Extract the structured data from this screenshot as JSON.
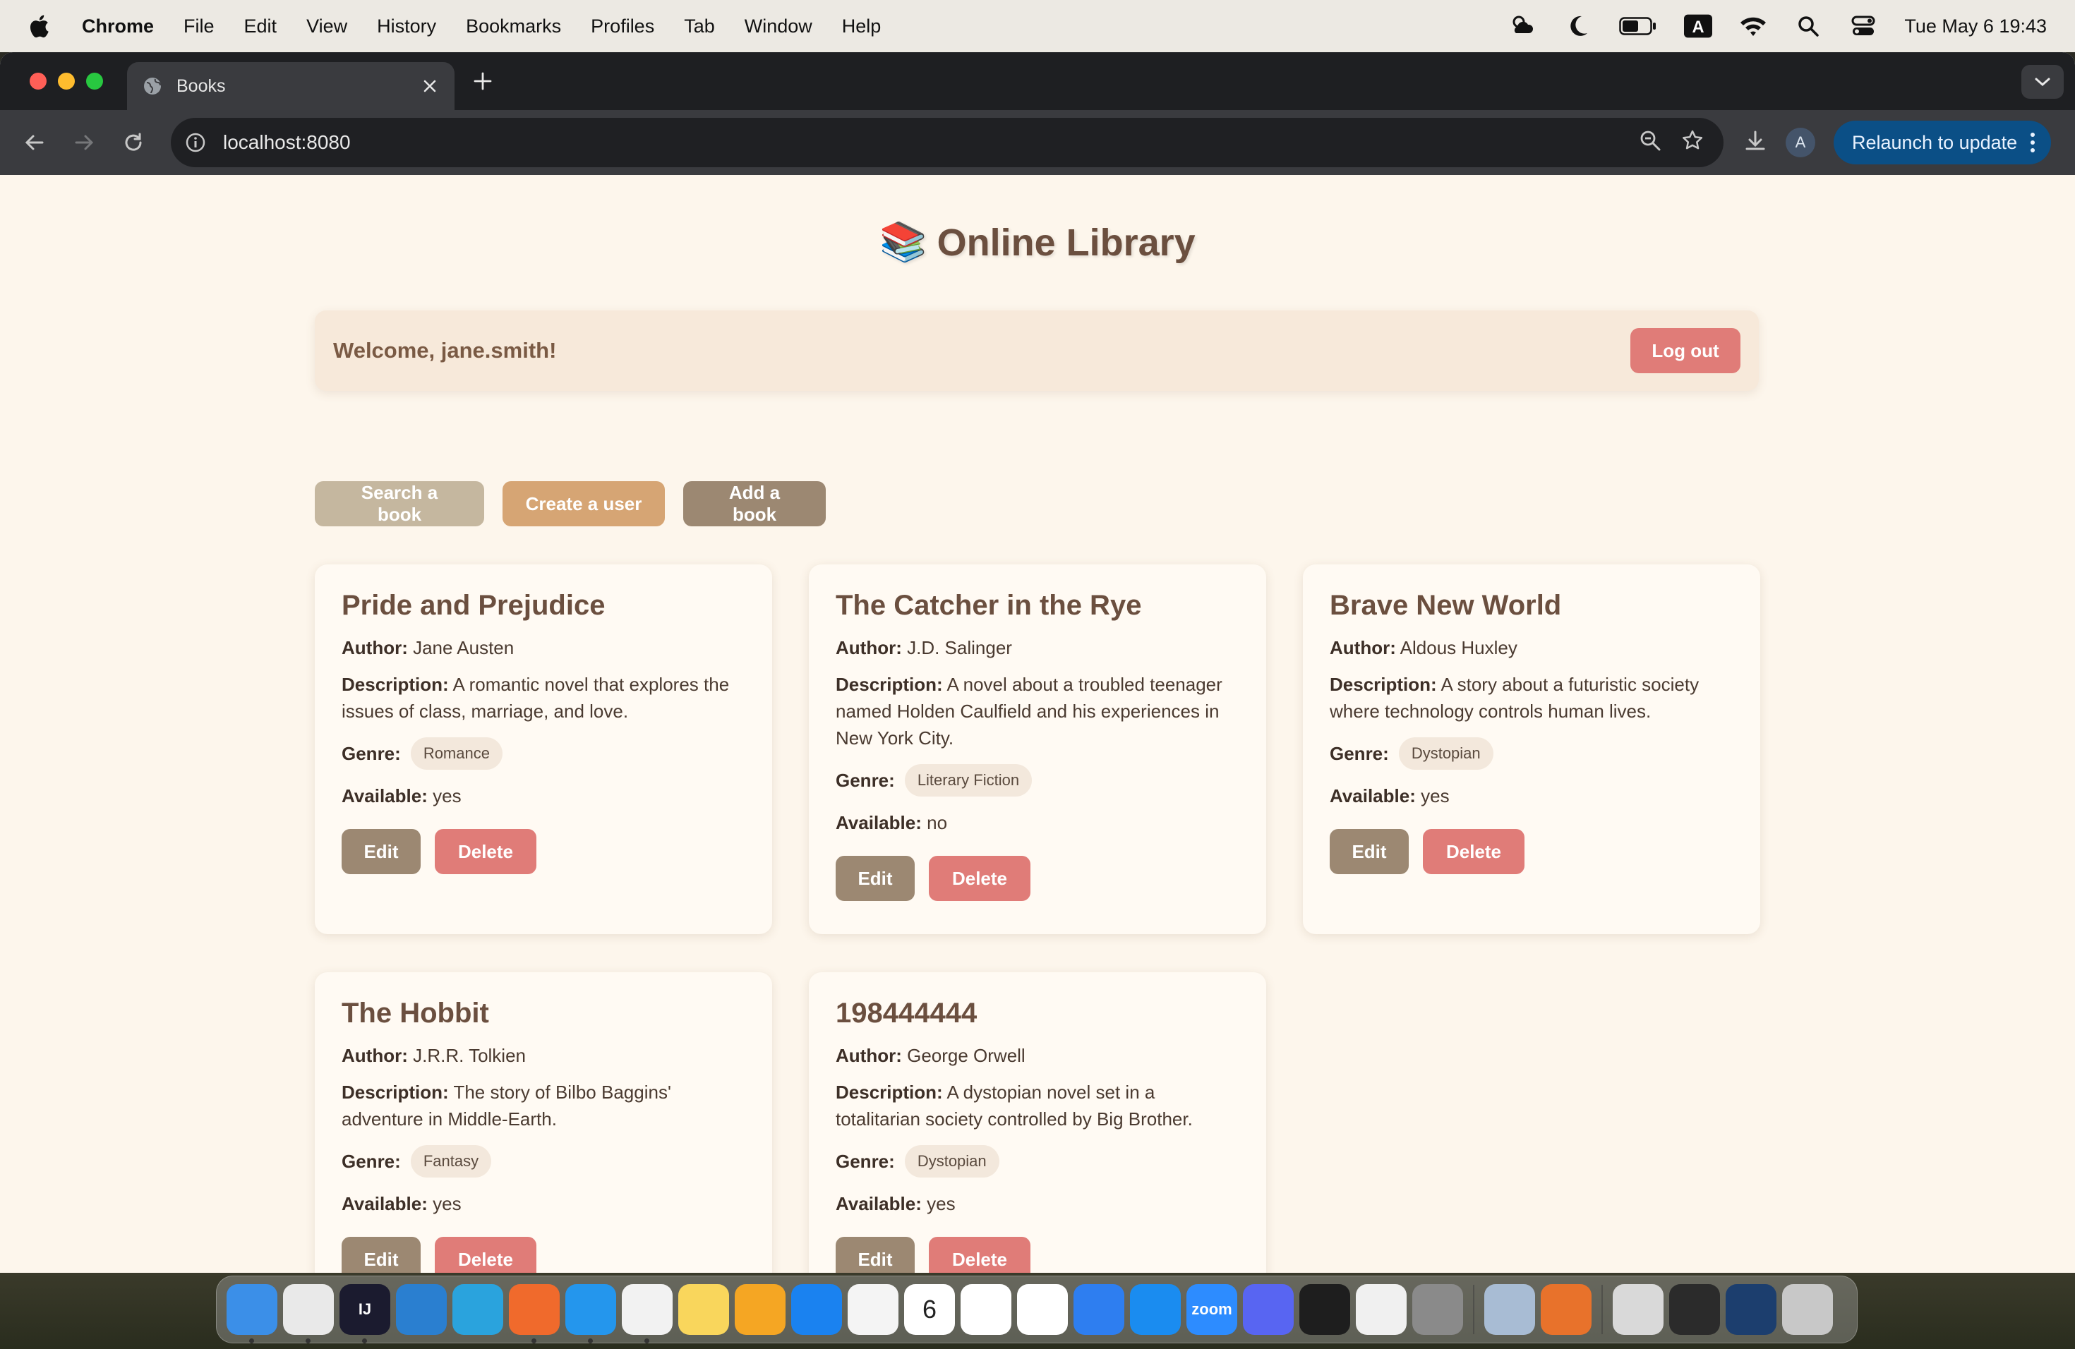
{
  "menubar": {
    "items": [
      "Chrome",
      "File",
      "Edit",
      "View",
      "History",
      "Bookmarks",
      "Profiles",
      "Tab",
      "Window",
      "Help"
    ],
    "clock": "Tue May 6  19:43"
  },
  "browser": {
    "tab_title": "Books",
    "url": "localhost:8080",
    "avatar_letter": "A",
    "relaunch_label": "Relaunch to update"
  },
  "page": {
    "title": "Online Library",
    "title_emoji": "📚",
    "welcome": "Welcome, jane.smith!",
    "logout_label": "Log out",
    "actions": {
      "search": "Search a book",
      "create_user": "Create a user",
      "add_book": "Add a book"
    },
    "labels": {
      "author": "Author:",
      "description": "Description:",
      "genre": "Genre:",
      "available": "Available:",
      "edit": "Edit",
      "delete": "Delete"
    },
    "books": [
      {
        "title": "Pride and Prejudice",
        "author": "Jane Austen",
        "description": "A romantic novel that explores the issues of class, marriage, and love.",
        "genre": "Romance",
        "available": "yes"
      },
      {
        "title": "The Catcher in the Rye",
        "author": "J.D. Salinger",
        "description": "A novel about a troubled teenager named Holden Caulfield and his experiences in New York City.",
        "genre": "Literary Fiction",
        "available": "no"
      },
      {
        "title": "Brave New World",
        "author": "Aldous Huxley",
        "description": "A story about a futuristic society where technology controls human lives.",
        "genre": "Dystopian",
        "available": "yes"
      },
      {
        "title": "The Hobbit",
        "author": "J.R.R. Tolkien",
        "description": "The story of Bilbo Baggins' adventure in Middle-Earth.",
        "genre": "Fantasy",
        "available": "yes"
      },
      {
        "title": "198444444",
        "author": "George Orwell",
        "description": "A dystopian novel set in a totalitarian society controlled by Big Brother.",
        "genre": "Dystopian",
        "available": "yes"
      }
    ]
  },
  "dock": {
    "apps": [
      {
        "name": "finder",
        "color": "#3b8fe8",
        "running": true
      },
      {
        "name": "chrome",
        "color": "#e9e9e9",
        "running": true
      },
      {
        "name": "intellij",
        "color": "#1b1b2f",
        "label": "IJ",
        "running": true
      },
      {
        "name": "vscode",
        "color": "#2a7fd0",
        "running": false
      },
      {
        "name": "telegram",
        "color": "#2aa3dd",
        "running": false
      },
      {
        "name": "postman",
        "color": "#f06a2c",
        "running": true
      },
      {
        "name": "docker",
        "color": "#2496ed",
        "running": true
      },
      {
        "name": "tableplus",
        "color": "#f2f2f2",
        "running": true
      },
      {
        "name": "notes",
        "color": "#f9d65c",
        "running": false
      },
      {
        "name": "pages",
        "color": "#f5a623",
        "running": false
      },
      {
        "name": "safari",
        "color": "#1a82f0",
        "running": false
      },
      {
        "name": "photos",
        "color": "#f4f4f4",
        "running": false
      },
      {
        "name": "calendar",
        "color": "#ffffff",
        "label": "6",
        "running": false
      },
      {
        "name": "reminders",
        "color": "#ffffff",
        "running": false
      },
      {
        "name": "freeform",
        "color": "#ffffff",
        "running": false
      },
      {
        "name": "keynote",
        "color": "#2e7ef0",
        "running": false
      },
      {
        "name": "app-store",
        "color": "#1a8cf0",
        "running": false
      },
      {
        "name": "zoom",
        "color": "#2d8cff",
        "label": "zoom",
        "running": false
      },
      {
        "name": "discord",
        "color": "#5865f2",
        "running": false
      },
      {
        "name": "terminal",
        "color": "#1e1e1e",
        "running": false
      },
      {
        "name": "textedit",
        "color": "#f0f0f0",
        "running": false
      },
      {
        "name": "system-settings",
        "color": "#8a8a8a",
        "running": false
      },
      {
        "name": "preview",
        "color": "#a8bcd4",
        "running": false
      },
      {
        "name": "firefox",
        "color": "#e8722b",
        "running": false
      },
      {
        "name": "launchpad-folder",
        "color": "#d9d9d9",
        "running": false
      },
      {
        "name": "recent-window-1",
        "color": "#2b2b2b",
        "running": false
      },
      {
        "name": "recent-window-2",
        "color": "#1c3e6e",
        "running": false
      },
      {
        "name": "trash",
        "color": "#c8c8c8",
        "running": false
      }
    ]
  }
}
